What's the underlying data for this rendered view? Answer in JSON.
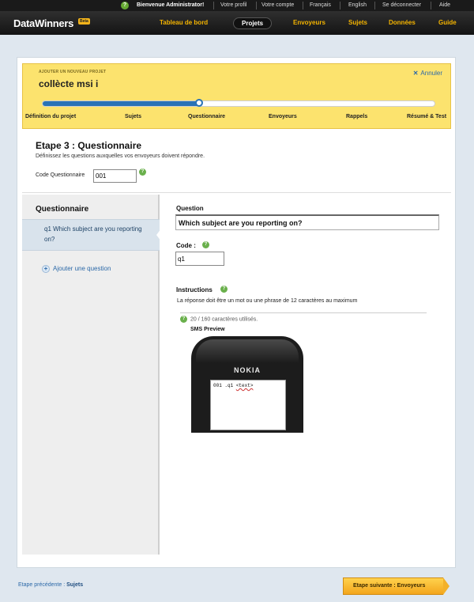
{
  "topbar": {
    "welcome": "Bienvenue Administrator!",
    "items": [
      "Votre profil",
      "Votre compte",
      "Français",
      "English",
      "Se déconnecter",
      "Aide"
    ]
  },
  "nav": {
    "logo": "DataWinners",
    "beta": "Beta",
    "tabs": [
      "Tableau de bord",
      "Projets",
      "Envoyeurs",
      "Sujets",
      "Données",
      "Guide"
    ],
    "active_tab": "Projets"
  },
  "banner": {
    "subtitle": "AJOUTER UN NOUVEAU PROJET",
    "project_name": "collècte msi i",
    "cancel": "Annuler",
    "progress": 0.4,
    "steps": [
      "Définition du projet",
      "Sujets",
      "Questionnaire",
      "Envoyeurs",
      "Rappels",
      "Résumé & Test"
    ]
  },
  "step": {
    "title": "Etape 3 : Questionnaire",
    "description": "Définissez les questions auxquelles vos envoyeurs doivent répondre.",
    "code_label": "Code Questionnaire",
    "code_value": "001"
  },
  "sidebar": {
    "heading": "Questionnaire",
    "selected_question": "q1 Which subject are you reporting on?",
    "add_question": "Ajouter une question"
  },
  "editor": {
    "question_label": "Question",
    "question_value": "Which subject are you reporting on?",
    "code_label": "Code :",
    "code_value": "q1",
    "instructions_label": "Instructions",
    "instructions_text": "La réponse doit être un mot ou une phrase de 12 caractères au maximum",
    "char_counter": "20 / 160 caractères utilisés.",
    "sms_preview_label": "SMS Preview",
    "phone_brand": "NOKIA",
    "sms_prefix": "001 .q1 ",
    "sms_tag": "<text>"
  },
  "footer": {
    "prev_label": "Etape précédente : ",
    "prev_link": "Sujets",
    "next_button": "Etape suivante : Envoyeurs"
  }
}
